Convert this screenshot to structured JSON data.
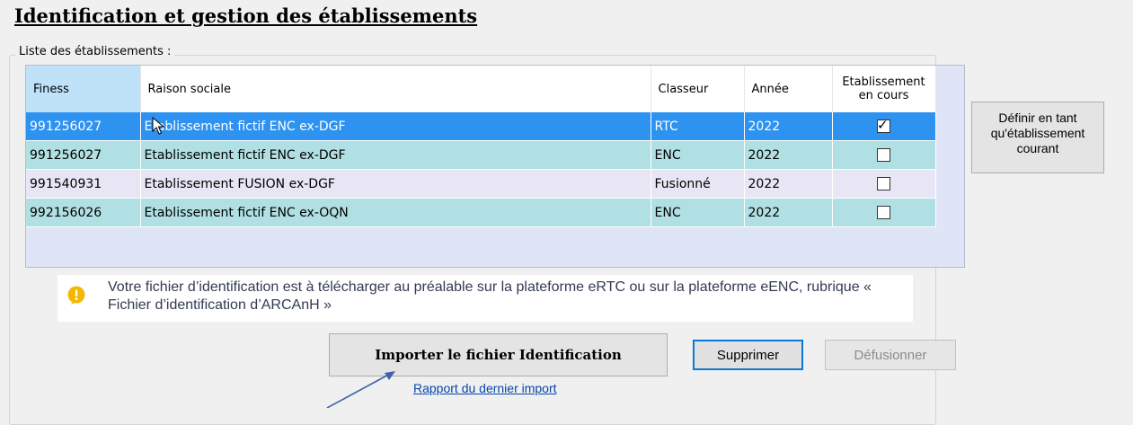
{
  "title": "Identification et gestion des établissements",
  "group_label": "Liste des établissements :",
  "grid": {
    "headers": {
      "finess": "Finess",
      "raison": "Raison sociale",
      "classeur": "Classeur",
      "annee": "Année",
      "etab_line1": "Etablissement",
      "etab_line2": "en cours"
    },
    "rows": [
      {
        "finess": "991256027",
        "raison": "Etablissement fictif ENC ex-DGF",
        "classeur": "RTC",
        "annee": "2022",
        "en_cours": true
      },
      {
        "finess": "991256027",
        "raison": "Etablissement fictif ENC ex-DGF",
        "classeur": "ENC",
        "annee": "2022",
        "en_cours": false
      },
      {
        "finess": "991540931",
        "raison": "Etablissement FUSION ex-DGF",
        "classeur": "Fusionné",
        "annee": "2022",
        "en_cours": false
      },
      {
        "finess": "992156026",
        "raison": "Etablissement fictif ENC ex-OQN",
        "classeur": "ENC",
        "annee": "2022",
        "en_cours": false
      }
    ],
    "selected_row": 0
  },
  "buttons": {
    "define_current": "Définir en tant qu'établissement courant",
    "import": "Importer le fichier Identification",
    "delete": "Supprimer",
    "unmerge": "Défusionner"
  },
  "info": {
    "icon": "info-icon",
    "text": "Votre fichier d’identification est à télécharger au préalable sur la plateforme eRTC ou sur la plateforme eENC, rubrique « Fichier d’identification d’ARCAnH »"
  },
  "links": {
    "last_import_report": "Rapport du dernier import"
  },
  "colors": {
    "selected_row": "#2e92f0",
    "row_alt": "#b0e0e3",
    "row_light": "#e8e6f4",
    "grid_background": "#dfe4f6",
    "sorted_header": "#bfe2f8",
    "link": "#0645ad",
    "focus_border": "#0b78d7"
  }
}
